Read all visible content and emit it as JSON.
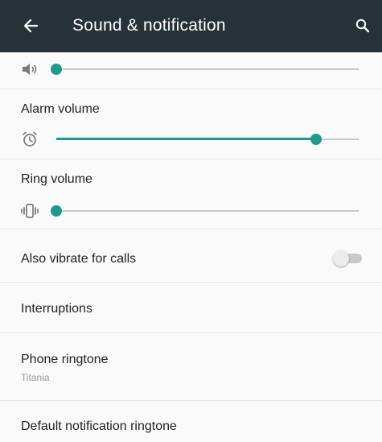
{
  "header": {
    "title": "Sound & notification",
    "back_icon": "arrow-back-icon",
    "search_icon": "search-icon",
    "background_color": "#263238"
  },
  "accent_color": "#1b9b8c",
  "volumes": {
    "media": {
      "icon": "speaker-icon",
      "level": 0.0
    },
    "alarm": {
      "label": "Alarm volume",
      "icon": "alarm-clock-icon",
      "level": 0.86
    },
    "ring": {
      "label": "Ring volume",
      "icon": "vibrate-icon",
      "level": 0.0
    }
  },
  "vibrate_for_calls": {
    "label": "Also vibrate for calls",
    "enabled": false
  },
  "interruptions": {
    "label": "Interruptions"
  },
  "phone_ringtone": {
    "label": "Phone ringtone",
    "value": "Titania"
  },
  "notification_ringtone": {
    "label": "Default notification ringtone"
  }
}
